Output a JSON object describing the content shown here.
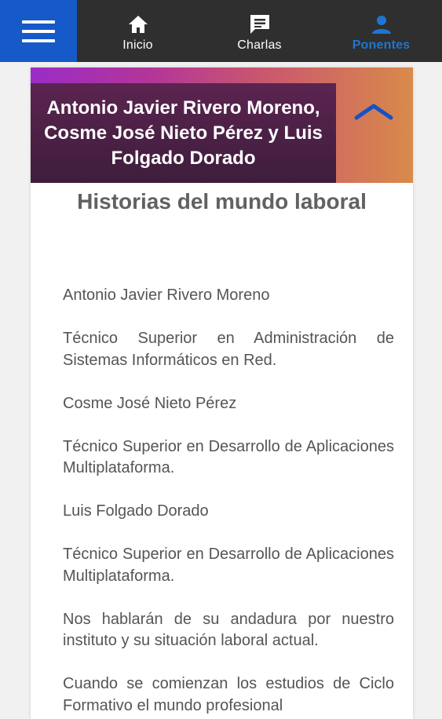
{
  "nav": {
    "menu_icon": "hamburger-menu-icon",
    "tabs": [
      {
        "label": "Inicio",
        "icon": "home-icon",
        "active": false
      },
      {
        "label": "Charlas",
        "icon": "chat-icon",
        "active": false
      },
      {
        "label": "Ponentes",
        "icon": "person-icon",
        "active": true
      }
    ],
    "colors": {
      "bar": "#2f2f2f",
      "menu": "#1659c9",
      "active": "#1e76d2"
    }
  },
  "card": {
    "speakers": "Antonio Javier Rivero Moreno, Cosme José Nieto Pérez y Luis Folgado Dorado",
    "collapse_icon": "chevron-up-icon",
    "talk_title": "Historias del mundo laboral",
    "paragraphs": [
      "Antonio Javier Rivero Moreno",
      "Técnico Superior en Administración de Sistemas Informáticos en Red.",
      "Cosme José Nieto Pérez",
      "Técnico Superior en Desarrollo de Aplicaciones Multiplataforma.",
      "Luis Folgado Dorado",
      "Técnico Superior en Desarrollo de Aplicaciones Multiplataforma.",
      "Nos hablarán de su andadura por nuestro instituto y su situación laboral actual.",
      "Cuando se comienzan los estudios de Ciclo Formativo el mundo profesional"
    ]
  }
}
